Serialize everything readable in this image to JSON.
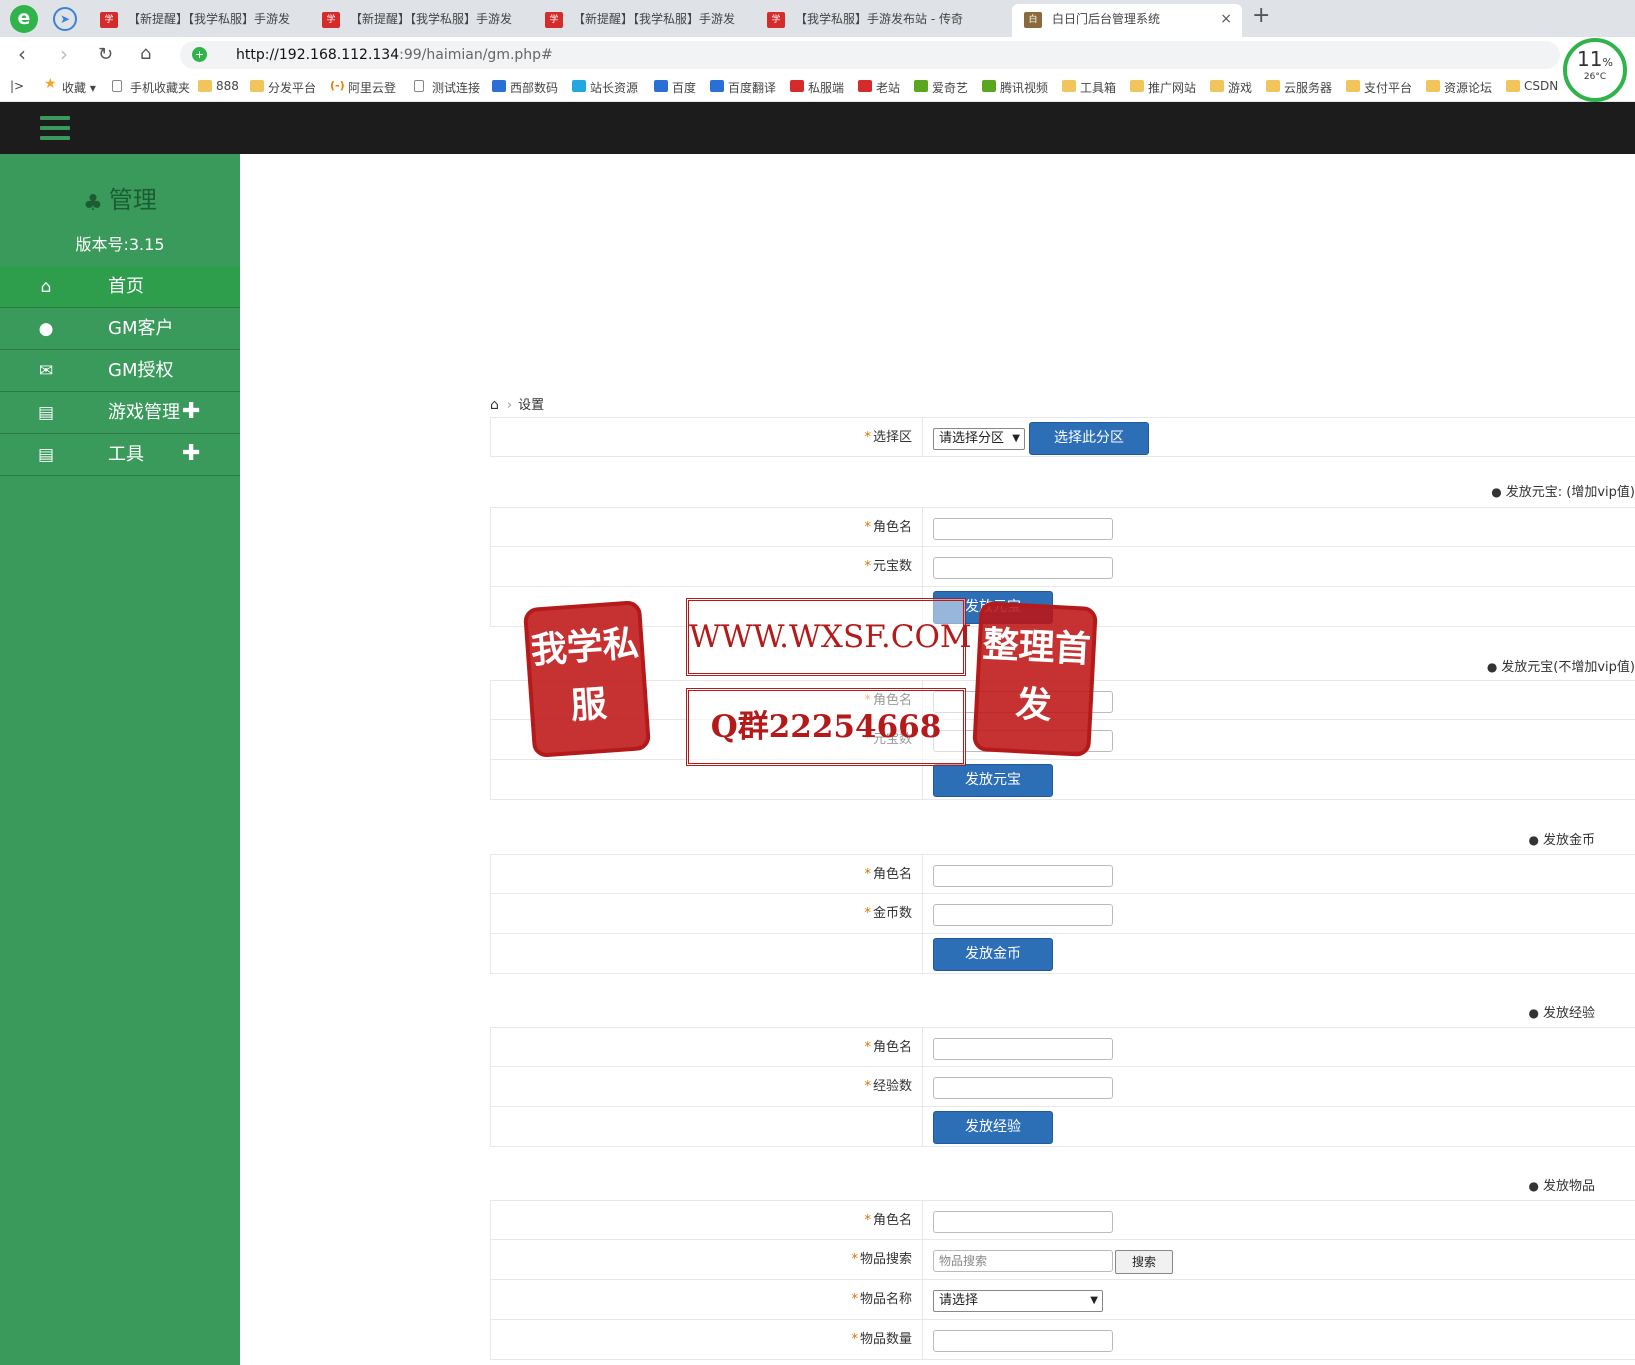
{
  "browser": {
    "tabs": [
      {
        "title": "【新提醒】【我学私服】手游发"
      },
      {
        "title": "【新提醒】【我学私服】手游发"
      },
      {
        "title": "【新提醒】【我学私服】手游发"
      },
      {
        "title": "【我学私服】手游发布站 - 传奇"
      },
      {
        "title": "白日门后台管理系统",
        "active": true
      }
    ],
    "new_tab": "+",
    "close": "×",
    "url_host": "http://192.168.112.134",
    "url_rest": ":99/haimian/gm.php#",
    "cpu_percent": "11",
    "cpu_unit": "%",
    "temperature": "26°C",
    "bookmarks": [
      "收藏",
      "手机收藏夹",
      "888",
      "分发平台",
      "阿里云登",
      "测试连接",
      "西部数码",
      "站长资源",
      "百度",
      "百度翻译",
      "私服端",
      "老站",
      "爱奇艺",
      "腾讯视频",
      "工具箱",
      "推广网站",
      "游戏",
      "云服务器",
      "支付平台",
      "资源论坛",
      "CSDN"
    ]
  },
  "sidebar": {
    "title": "管理",
    "version": "版本号:3.15",
    "items": [
      {
        "label": "首页",
        "icon": "home-icon"
      },
      {
        "label": "GM客户",
        "icon": "user-icon"
      },
      {
        "label": "GM授权",
        "icon": "envelope-icon"
      },
      {
        "label": "游戏管理",
        "icon": "briefcase-icon",
        "expand": "✚"
      },
      {
        "label": "工具",
        "icon": "briefcase-icon",
        "expand": "✚"
      }
    ]
  },
  "breadcrumb": {
    "current": "设置"
  },
  "zone": {
    "label": "选择区",
    "select_value": "请选择分区",
    "button": "选择此分区"
  },
  "sections": {
    "yuanbao_vip": {
      "title": "发放元宝: (增加vip值)",
      "name_label": "角色名",
      "amount_label": "元宝数",
      "button": "发放元宝"
    },
    "yuanbao_novip": {
      "title": "发放元宝(不增加vip值)",
      "name_label": "角色名",
      "amount_label": "元宝数",
      "button": "发放元宝"
    },
    "gold": {
      "title": "发放金币",
      "name_label": "角色名",
      "amount_label": "金币数",
      "button": "发放金币"
    },
    "exp": {
      "title": "发放经验",
      "name_label": "角色名",
      "amount_label": "经验数",
      "button": "发放经验"
    },
    "item": {
      "title": "发放物品",
      "name_label": "角色名",
      "search_label": "物品搜索",
      "search_placeholder": "物品搜索",
      "search_button": "搜索",
      "item_name_label": "物品名称",
      "item_select_value": "请选择",
      "qty_label": "物品数量"
    }
  },
  "watermark": {
    "seal_left": "我学私服",
    "url": "WWW.WXSF.COM",
    "qq": "Q群22254668",
    "seal_right": "整理首发"
  },
  "required_mark": "*"
}
